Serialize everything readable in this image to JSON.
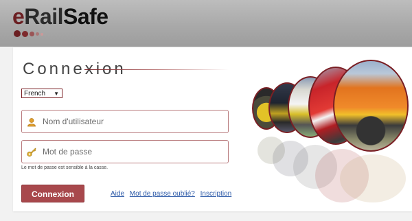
{
  "brand": {
    "logo_e": "e",
    "logo_rail": "Rail",
    "logo_safe": "Safe"
  },
  "login": {
    "title": "Connexion",
    "language": "French",
    "username_placeholder": "Nom d'utilisateur",
    "password_placeholder": "Mot de passe",
    "password_hint": "Le mot de passe est sensible à la casse.",
    "submit_label": "Connexion",
    "links": [
      "Aide",
      "Mot de passe oublié?",
      "Inscription"
    ]
  },
  "colors": {
    "accent": "#7a1f24",
    "button": "#a8484c",
    "link": "#2d5aa8"
  },
  "icons": {
    "username": "user-icon",
    "password": "key-icon"
  }
}
